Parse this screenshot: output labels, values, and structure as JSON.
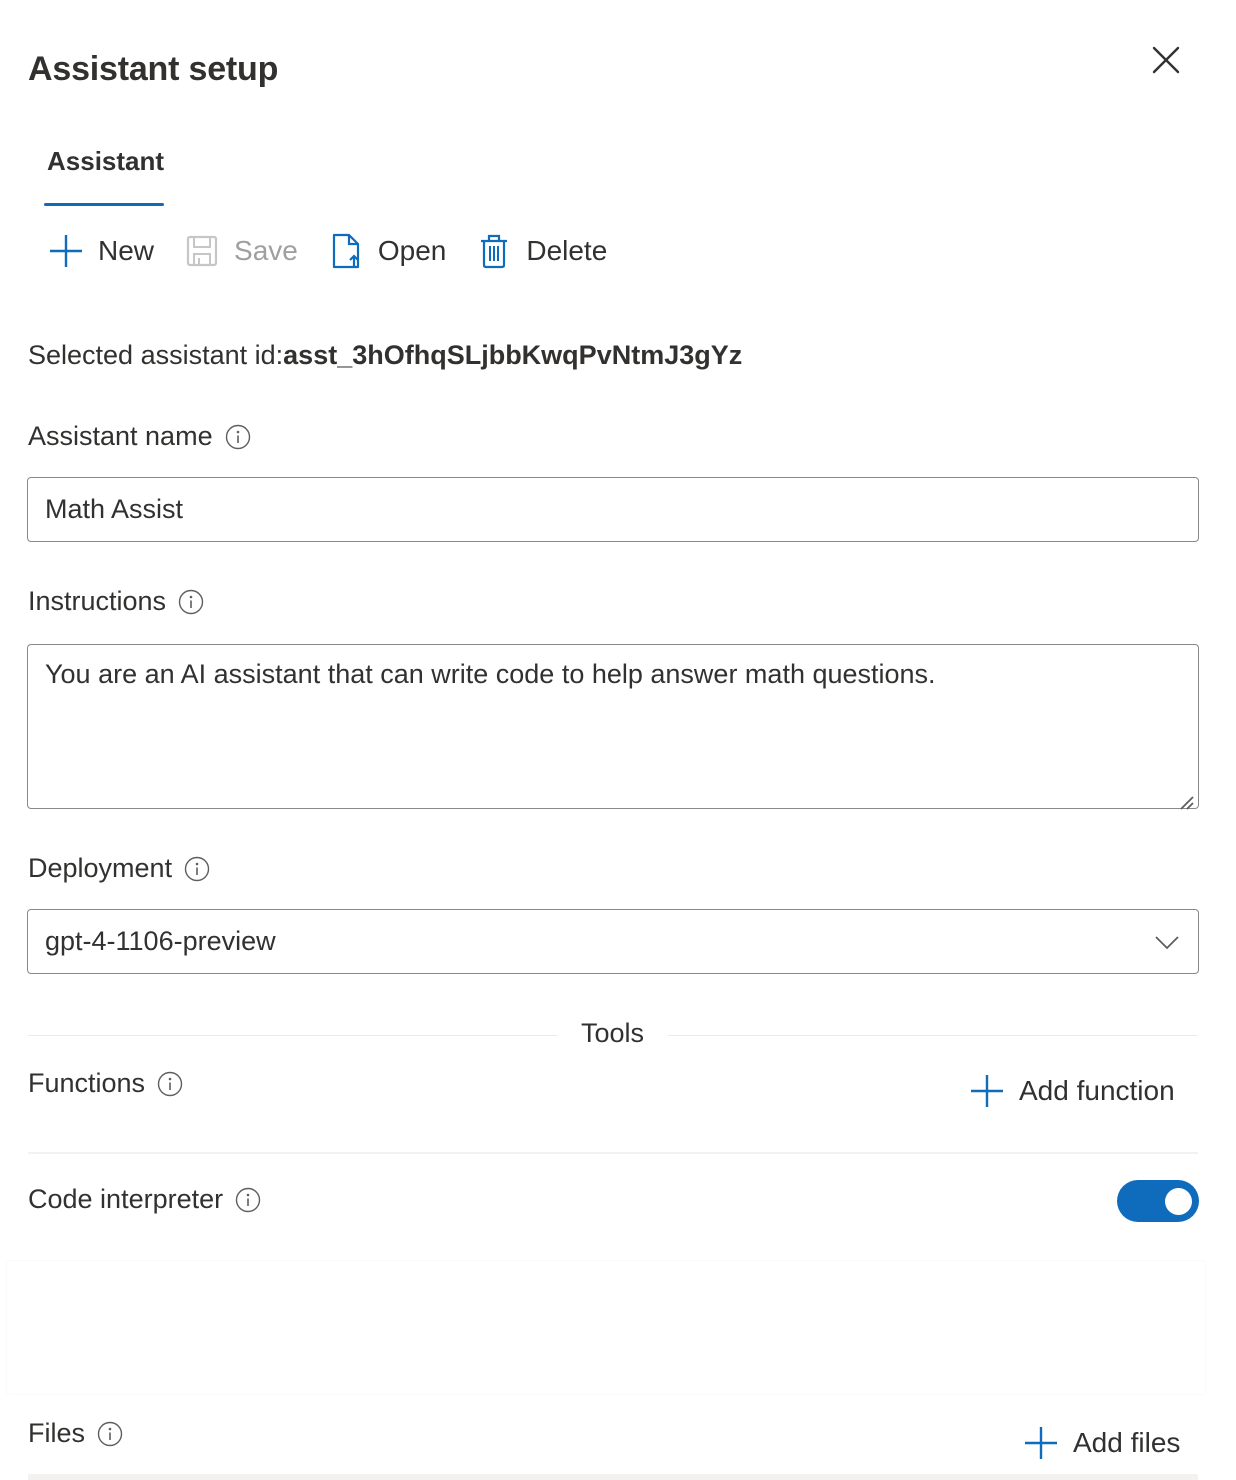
{
  "panel": {
    "title": "Assistant setup",
    "close_icon": "close-icon"
  },
  "tabs": [
    {
      "label": "Assistant",
      "selected": true
    }
  ],
  "toolbar": {
    "new_label": "New",
    "save_label": "Save",
    "save_disabled": true,
    "open_label": "Open",
    "delete_label": "Delete"
  },
  "selected_assistant": {
    "prefix": "Selected assistant id:",
    "id": "asst_3hOfhqSLjbbKwqPvNtmJ3gYz"
  },
  "form": {
    "assistant_name": {
      "label": "Assistant name",
      "value": "Math Assist"
    },
    "instructions": {
      "label": "Instructions",
      "value": "You are an AI assistant that can write code to help answer math questions."
    },
    "deployment": {
      "label": "Deployment",
      "selected": "gpt-4-1106-preview"
    }
  },
  "tools": {
    "section_label": "Tools",
    "functions": {
      "label": "Functions",
      "add_label": "Add function"
    },
    "code_interpreter": {
      "label": "Code interpreter",
      "enabled": true
    },
    "files": {
      "label": "Files",
      "add_label": "Add files"
    }
  },
  "colors": {
    "accent": "#0f6cbd",
    "text": "#323130",
    "disabled": "#a19f9d",
    "border": "#8a8886"
  }
}
